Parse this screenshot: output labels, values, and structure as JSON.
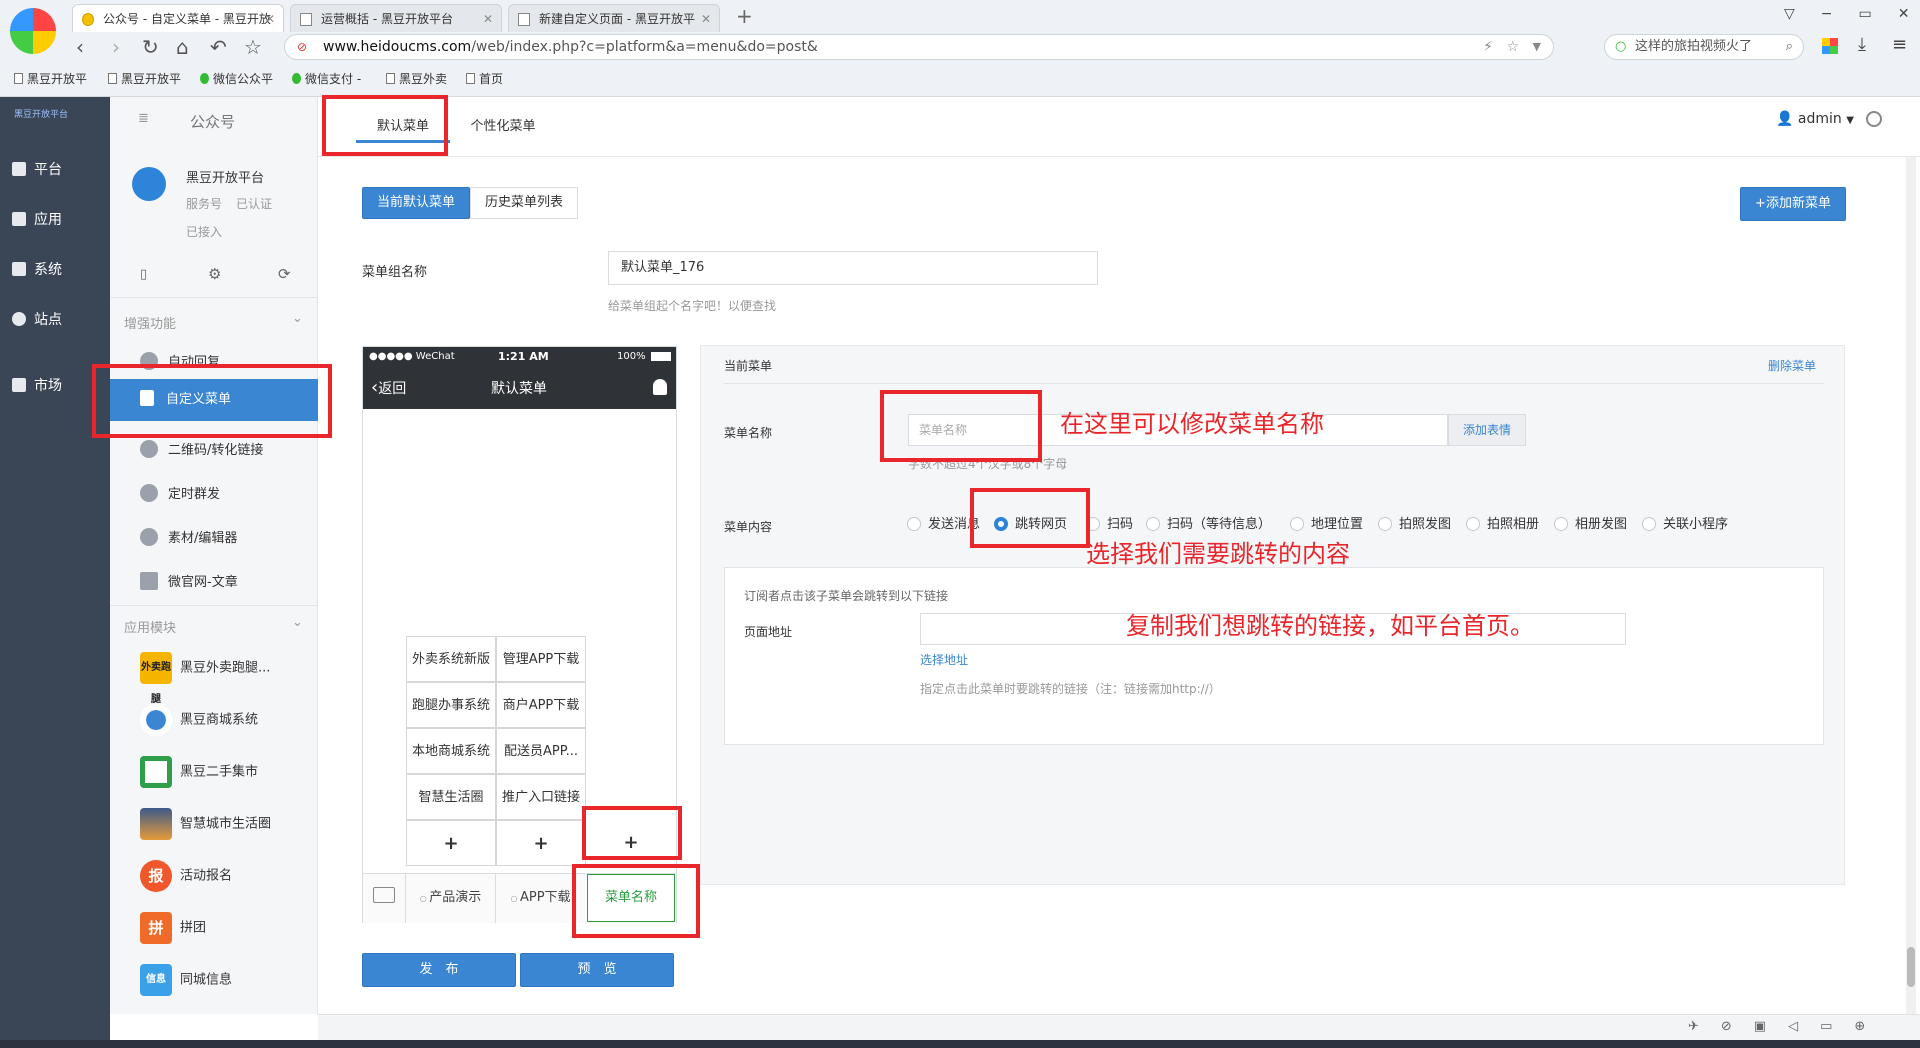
{
  "browser": {
    "tabs": [
      {
        "title": "公众号 - 自定义菜单 - 黑豆开放",
        "active": true
      },
      {
        "title": "运营概括 - 黑豆开放平台",
        "active": false
      },
      {
        "title": "新建自定义页面 - 黑豆开放平",
        "active": false
      }
    ],
    "url_domain": "www.heidoucms.com",
    "url_path": "/web/index.php?c=platform&a=menu&do=post&",
    "search_text": "这样的旅拍视频火了",
    "bookmarks": [
      "黑豆开放平",
      "黑豆开放平",
      "微信公众平",
      "微信支付 -",
      "黑豆外卖",
      "首页"
    ]
  },
  "leftnav": {
    "logo": "黑豆开放平台",
    "items": [
      "平台",
      "应用",
      "系统",
      "站点",
      "市场"
    ]
  },
  "sidebar": {
    "header": "公众号",
    "account": {
      "name": "黑豆开放平台",
      "type": "服务号",
      "verified": "已认证",
      "status": "已接入"
    },
    "section_enhanced": "增强功能",
    "enhanced_items": [
      "自动回复",
      "自定义菜单",
      "二维码/转化链接",
      "定时群发",
      "素材/编辑器",
      "微官网-文章"
    ],
    "section_apps": "应用模块",
    "apps": [
      {
        "name": "黑豆外卖跑腿...",
        "label": "外卖跑腿",
        "color": "#f5b400"
      },
      {
        "name": "黑豆商城系统",
        "label": "",
        "color": "#ffffff"
      },
      {
        "name": "黑豆二手集市",
        "label": "",
        "color": "#2e9e4b"
      },
      {
        "name": "智慧城市生活圈",
        "label": "",
        "color": "#3c5a8a"
      },
      {
        "name": "活动报名",
        "label": "报",
        "color": "#f0572a"
      },
      {
        "name": "拼团",
        "label": "拼",
        "color": "#f06a2a"
      },
      {
        "name": "同城信息",
        "label": "信息",
        "color": "#3aa0e8"
      }
    ]
  },
  "topbar": {
    "tabs": [
      "默认菜单",
      "个性化菜单"
    ],
    "user": "admin"
  },
  "main": {
    "btn_current": "当前默认菜单",
    "btn_history": "历史菜单列表",
    "btn_add": "+添加新菜单",
    "group_label": "菜单组名称",
    "group_value": "默认菜单_176",
    "group_hint": "给菜单组起个名字吧！以便查找",
    "phone": {
      "carrier": "●●●●● WeChat",
      "time": "1:21 AM",
      "battery": "100%",
      "back": "返回",
      "title": "默认菜单",
      "submenu_col1": [
        "外卖系统新版",
        "跑腿办事系统",
        "本地商城系统",
        "智慧生活圈"
      ],
      "submenu_col2": [
        "管理APP下载",
        "商户APP下载",
        "配送员APP...",
        "推广入口链接"
      ],
      "plus": "+",
      "bottom_menu": [
        "产品演示",
        "APP下载",
        "菜单名称"
      ]
    },
    "editor": {
      "current_menu": "当前菜单",
      "delete": "删除菜单",
      "name_label": "菜单名称",
      "name_placeholder": "菜单名称",
      "add_emoji": "添加表情",
      "name_hint": "字数不超过4个汉字或8个字母",
      "content_label": "菜单内容",
      "options": [
        "发送消息",
        "跳转网页",
        "扫码",
        "扫码（等待信息）",
        "地理位置",
        "拍照发图",
        "拍照相册",
        "相册发图",
        "关联小程序"
      ],
      "selected": "跳转网页",
      "jump_desc": "订阅者点击该子菜单会跳转到以下链接",
      "page_label": "页面地址",
      "choose": "选择地址",
      "link_hint": "指定点击此菜单时要跳转的链接（注：链接需加http://）"
    },
    "publish": "发　布",
    "preview": "预　览"
  },
  "annotations": {
    "a1": "在这里可以修改菜单名称",
    "a2": "选择我们需要跳转的内容",
    "a3": "复制我们想跳转的链接，如平台首页。"
  }
}
